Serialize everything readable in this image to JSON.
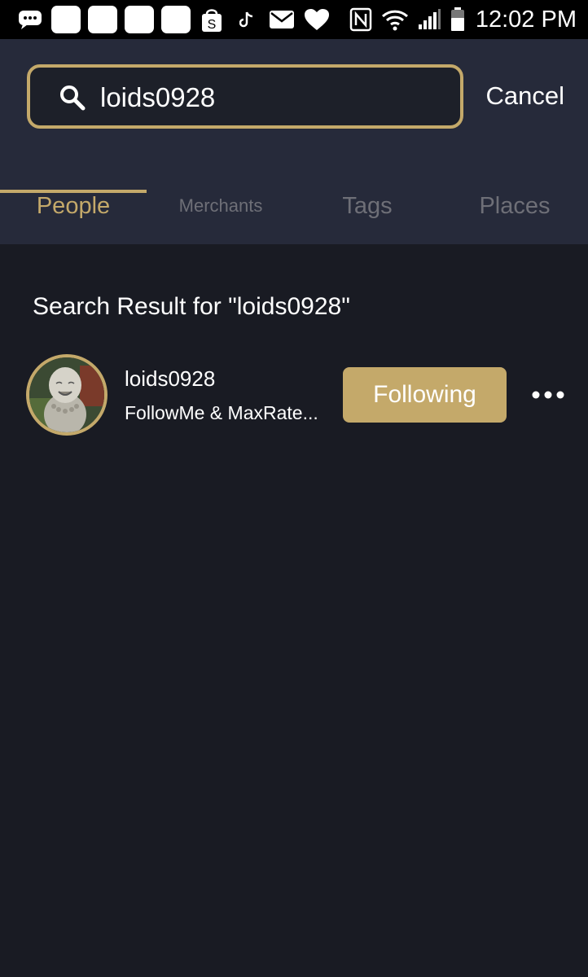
{
  "status_bar": {
    "time": "12:02 PM",
    "notification_icons": [
      "chat-dots-icon",
      "app-icon",
      "app-icon",
      "app-icon",
      "app-icon",
      "shopee-bag-icon",
      "tiktok-icon",
      "mail-icon",
      "heart-icon"
    ],
    "system_icons": [
      "nfc-icon",
      "wifi-icon",
      "signal-icon",
      "battery-icon"
    ]
  },
  "search": {
    "value": "loids0928",
    "cancel_label": "Cancel"
  },
  "tabs": [
    {
      "label": "People",
      "active": true
    },
    {
      "label": "Merchants",
      "active": false
    },
    {
      "label": "Tags",
      "active": false
    },
    {
      "label": "Places",
      "active": false
    }
  ],
  "results": {
    "heading": "Search Result for \"loids0928\"",
    "items": [
      {
        "username": "loids0928",
        "bio": "FollowMe & MaxRate...",
        "button_label": "Following"
      }
    ]
  },
  "colors": {
    "accent": "#c4a96a",
    "header_bg": "#262a3a",
    "page_bg": "#191b23",
    "inactive_tab": "#6e6f77"
  }
}
